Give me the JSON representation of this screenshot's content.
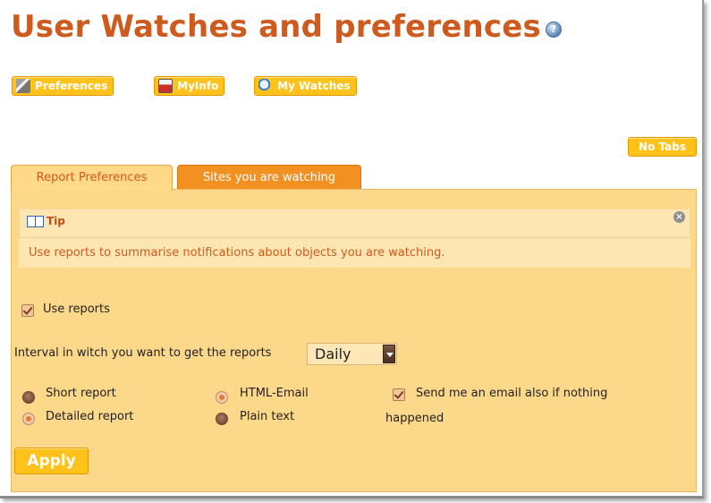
{
  "page": {
    "title": "User Watches and preferences",
    "help_icon": "help-icon"
  },
  "nav": {
    "preferences_label": "Preferences",
    "myinfo_label": "MyInfo",
    "watches_label": "My Watches"
  },
  "no_tabs_label": "No Tabs",
  "tabs": [
    {
      "label": "Report Preferences",
      "active": true
    },
    {
      "label": "Sites you are watching",
      "active": false
    }
  ],
  "tip": {
    "heading": "Tip",
    "text": "Use reports to summarise notifications about objects you are watching.",
    "close_icon": "close-icon"
  },
  "form": {
    "use_reports_label": "Use reports",
    "use_reports_checked": true,
    "interval_label": "Interval in witch you want to get the reports",
    "interval_value": "Daily",
    "short_report_label": "Short report",
    "detailed_report_label": "Detailed report",
    "html_email_label": "HTML-Email",
    "plain_text_label": "Plain text",
    "send_email_label_line1": "Send me an email also if nothing",
    "send_email_label_line2": "happened",
    "send_email_checked": true,
    "report_type_selected": "Detailed report",
    "format_selected": "HTML-Email",
    "apply_label": "Apply"
  },
  "colors": {
    "title": "#cf5a1e",
    "button": "#ffc21a",
    "panel": "#fbd88a",
    "inactive_tab": "#f29122"
  }
}
